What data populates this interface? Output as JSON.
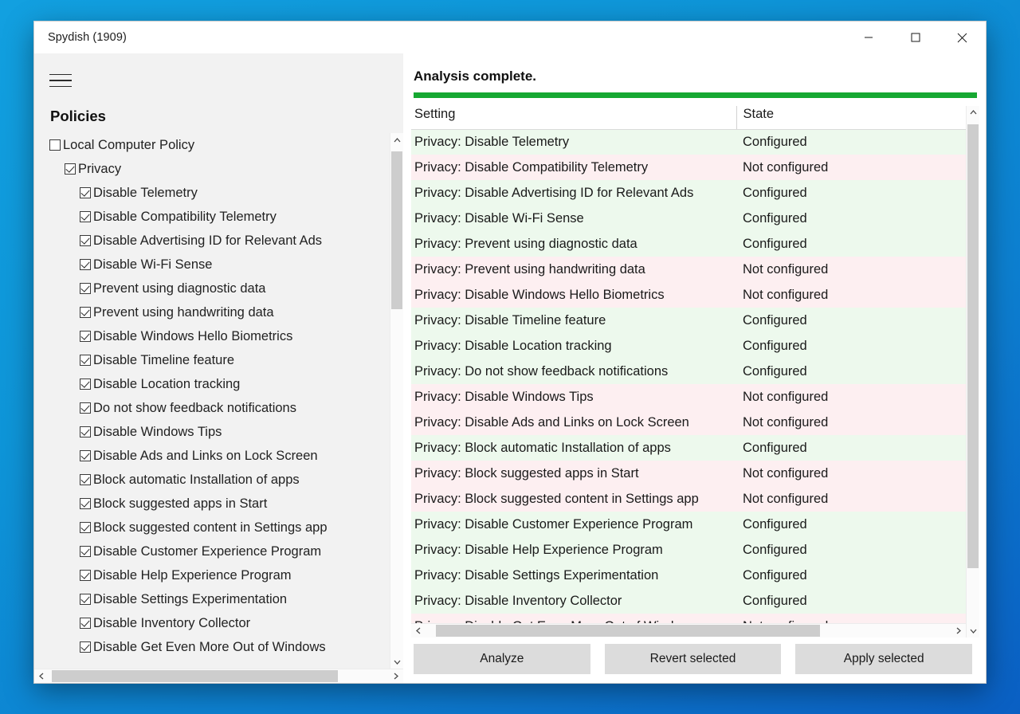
{
  "window": {
    "title": "Spydish (1909)",
    "controls": [
      {
        "name": "minimize",
        "glyph": "minimize-icon"
      },
      {
        "name": "maximize",
        "glyph": "maximize-icon"
      },
      {
        "name": "close",
        "glyph": "close-icon"
      }
    ]
  },
  "sidebar": {
    "menu_icon": "hamburger-menu-icon",
    "heading": "Policies",
    "tree": [
      {
        "label": "Local Computer Policy",
        "level": 0,
        "checked": false
      },
      {
        "label": "Privacy",
        "level": 1,
        "checked": true
      },
      {
        "label": "Disable Telemetry",
        "level": 2,
        "checked": true
      },
      {
        "label": "Disable Compatibility Telemetry",
        "level": 2,
        "checked": true
      },
      {
        "label": "Disable Advertising ID for Relevant Ads",
        "level": 2,
        "checked": true
      },
      {
        "label": "Disable Wi-Fi Sense",
        "level": 2,
        "checked": true
      },
      {
        "label": "Prevent using diagnostic data",
        "level": 2,
        "checked": true
      },
      {
        "label": "Prevent using handwriting data",
        "level": 2,
        "checked": true
      },
      {
        "label": "Disable Windows Hello Biometrics",
        "level": 2,
        "checked": true
      },
      {
        "label": "Disable Timeline feature",
        "level": 2,
        "checked": true
      },
      {
        "label": "Disable Location tracking",
        "level": 2,
        "checked": true
      },
      {
        "label": "Do not show feedback notifications",
        "level": 2,
        "checked": true
      },
      {
        "label": "Disable Windows Tips",
        "level": 2,
        "checked": true
      },
      {
        "label": "Disable Ads and Links on Lock Screen",
        "level": 2,
        "checked": true
      },
      {
        "label": "Block automatic Installation of apps",
        "level": 2,
        "checked": true
      },
      {
        "label": "Block suggested apps in Start",
        "level": 2,
        "checked": true
      },
      {
        "label": "Block suggested content in Settings app",
        "level": 2,
        "checked": true
      },
      {
        "label": "Disable Customer Experience Program",
        "level": 2,
        "checked": true
      },
      {
        "label": "Disable Help Experience Program",
        "level": 2,
        "checked": true
      },
      {
        "label": "Disable Settings Experimentation",
        "level": 2,
        "checked": true
      },
      {
        "label": "Disable Inventory Collector",
        "level": 2,
        "checked": true
      },
      {
        "label": "Disable Get Even More Out of Windows",
        "level": 2,
        "checked": true
      }
    ],
    "vscroll": {
      "thumb_top_pct": 1,
      "thumb_height_pct": 31
    },
    "hscroll": {
      "thumb_left_pct": 1,
      "thumb_width_pct": 84
    }
  },
  "main": {
    "status": "Analysis complete.",
    "progress": {
      "percent": 100,
      "color": "#16a832"
    },
    "columns": [
      "Setting",
      "State"
    ],
    "rows": [
      {
        "setting": "Privacy: Disable Telemetry",
        "state": "Configured"
      },
      {
        "setting": "Privacy: Disable Compatibility Telemetry",
        "state": "Not configured"
      },
      {
        "setting": "Privacy: Disable Advertising ID for Relevant Ads",
        "state": "Configured"
      },
      {
        "setting": "Privacy: Disable Wi-Fi Sense",
        "state": "Configured"
      },
      {
        "setting": "Privacy: Prevent using diagnostic data",
        "state": "Configured"
      },
      {
        "setting": "Privacy: Prevent using handwriting data",
        "state": "Not configured"
      },
      {
        "setting": "Privacy: Disable Windows Hello Biometrics",
        "state": "Not configured"
      },
      {
        "setting": "Privacy: Disable Timeline feature",
        "state": "Configured"
      },
      {
        "setting": "Privacy: Disable Location tracking",
        "state": "Configured"
      },
      {
        "setting": "Privacy: Do not show feedback notifications",
        "state": "Configured"
      },
      {
        "setting": "Privacy: Disable Windows Tips",
        "state": "Not configured"
      },
      {
        "setting": "Privacy: Disable Ads and Links on Lock Screen",
        "state": "Not configured"
      },
      {
        "setting": "Privacy: Block automatic Installation of apps",
        "state": "Configured"
      },
      {
        "setting": "Privacy: Block suggested apps in Start",
        "state": "Not configured"
      },
      {
        "setting": "Privacy: Block suggested content in Settings app",
        "state": "Not configured"
      },
      {
        "setting": "Privacy: Disable Customer Experience Program",
        "state": "Configured"
      },
      {
        "setting": "Privacy: Disable Help Experience Program",
        "state": "Configured"
      },
      {
        "setting": "Privacy: Disable Settings Experimentation",
        "state": "Configured"
      },
      {
        "setting": "Privacy: Disable Inventory Collector",
        "state": "Configured"
      },
      {
        "setting": "Privacy: Disable Get Even More Out of Windows",
        "state": "Not configured"
      }
    ],
    "vscroll": {
      "thumb_top_pct": 1,
      "thumb_height_pct": 88
    },
    "hscroll": {
      "thumb_left_pct": 2,
      "thumb_width_pct": 73
    }
  },
  "footer": {
    "analyze": "Analyze",
    "revert": "Revert selected",
    "apply": "Apply selected"
  },
  "colors": {
    "accent_green": "#16a832",
    "row_configured_bg": "#edf9ed",
    "row_not_configured_bg": "#fdeff1",
    "sidebar_bg": "#f2f2f2",
    "desktop_blue": "#0e95d8"
  }
}
